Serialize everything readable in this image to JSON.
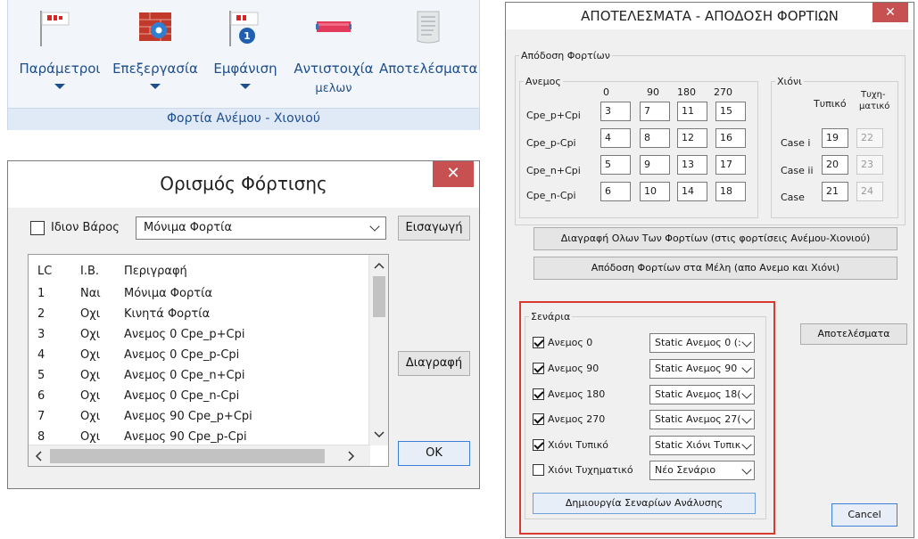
{
  "ribbon": {
    "buttons": [
      {
        "label": "Παράμετροι",
        "icon": "flag-icon",
        "dropdown": true
      },
      {
        "label": "Επεξεργασία",
        "icon": "wall-gear-icon",
        "dropdown": true
      },
      {
        "label": "Εμφάνιση",
        "icon": "flag-info-icon",
        "dropdown": true
      },
      {
        "label": "Αντιστοιχία",
        "label2": "μελων",
        "icon": "member-bar-icon",
        "dropdown": false
      },
      {
        "label": "Αποτελέσματα",
        "icon": "scroll-icon",
        "dropdown": false
      }
    ],
    "group_label": "Φορτία Ανέμου - Χιονιού"
  },
  "load_dialog": {
    "title": "Ορισμός Φόρτισης",
    "close_symbol": "✕",
    "self_weight_label": "Ιδιον Βάρος",
    "self_weight_checked": false,
    "combo_value": "Μόνιμα Φορτία",
    "insert_button": "Εισαγωγή",
    "delete_button": "Διαγραφή",
    "ok_button": "OK",
    "columns": [
      "LC",
      "I.B.",
      "Περιγραφή"
    ],
    "rows": [
      {
        "lc": "1",
        "ib": "Ναι",
        "desc": "Μόνιμα Φορτία"
      },
      {
        "lc": "2",
        "ib": "Οχι",
        "desc": "Κινητά Φορτία"
      },
      {
        "lc": "3",
        "ib": "Οχι",
        "desc": "Ανεμος 0 Cpe_p+Cpi"
      },
      {
        "lc": "4",
        "ib": "Οχι",
        "desc": "Ανεμος 0 Cpe_p-Cpi"
      },
      {
        "lc": "5",
        "ib": "Οχι",
        "desc": "Ανεμος 0 Cpe_n+Cpi"
      },
      {
        "lc": "6",
        "ib": "Οχι",
        "desc": "Ανεμος 0 Cpe_n-Cpi"
      },
      {
        "lc": "7",
        "ib": "Οχι",
        "desc": "Ανεμος 90 Cpe_p+Cpi"
      },
      {
        "lc": "8",
        "ib": "Οχι",
        "desc": "Ανεμος 90 Cpe_p-Cpi"
      }
    ]
  },
  "results_dialog": {
    "title": "ΑΠΟΤΕΛΕΣΜΑΤΑ - ΑΠΟΔΟΣΗ ΦΟΡΤΙΩΝ",
    "close_symbol": "✕",
    "load_group_label": "Απόδοση Φορτίων",
    "wind": {
      "label": "Ανεμος",
      "angles": [
        "0",
        "90",
        "180",
        "270"
      ],
      "rows": [
        {
          "label": "Cpe_p+Cpi",
          "values": [
            "3",
            "7",
            "11",
            "15"
          ]
        },
        {
          "label": "Cpe_p-Cpi",
          "values": [
            "4",
            "8",
            "12",
            "16"
          ]
        },
        {
          "label": "Cpe_n+Cpi",
          "values": [
            "5",
            "9",
            "13",
            "17"
          ]
        },
        {
          "label": "Cpe_n-Cpi",
          "values": [
            "6",
            "10",
            "14",
            "18"
          ]
        }
      ]
    },
    "snow": {
      "label": "Χιόνι",
      "col_typical": "Τυπικό",
      "col_accidental_1": "Τυχη-",
      "col_accidental_2": "ματικό",
      "rows": [
        {
          "label": "Case i",
          "typical": "19",
          "accidental": "22"
        },
        {
          "label": "Case ii",
          "typical": "20",
          "accidental": "23"
        },
        {
          "label": "Case",
          "typical": "21",
          "accidental": "24"
        }
      ]
    },
    "delete_all_button": "Διαγραφή Ολων Των Φορτίων (στις φορτίσεις Ανέμου-Χιονιού)",
    "assign_button": "Απόδοση Φορτίων στα Μέλη (απο Ανεμο και Χιόνι)",
    "scenarios": {
      "label": "Σενάρια",
      "rows": [
        {
          "label": "Ανεμος 0",
          "checked": true,
          "combo": "Static Ανεμος 0 (:"
        },
        {
          "label": "Ανεμος 90",
          "checked": true,
          "combo": "Static Ανεμος 90"
        },
        {
          "label": "Ανεμος 180",
          "checked": true,
          "combo": "Static Ανεμος 18("
        },
        {
          "label": "Ανεμος 270",
          "checked": true,
          "combo": "Static Ανεμος 27("
        },
        {
          "label": "Χιόνι Τυπικό",
          "checked": true,
          "combo": "Static Χιόνι Τυπικ"
        },
        {
          "label": "Χιόνι Τυχηματικό",
          "checked": false,
          "combo": "Νέο Σενάριο"
        }
      ],
      "create_button": "Δημιουργία Σεναρίων Ανάλυσης"
    },
    "results_button": "Αποτελέσματα",
    "cancel_button": "Cancel"
  },
  "colors": {
    "ribbon_text": "#1f4e8c",
    "close_button": "#c75050",
    "highlight_border": "#d83a2e"
  }
}
